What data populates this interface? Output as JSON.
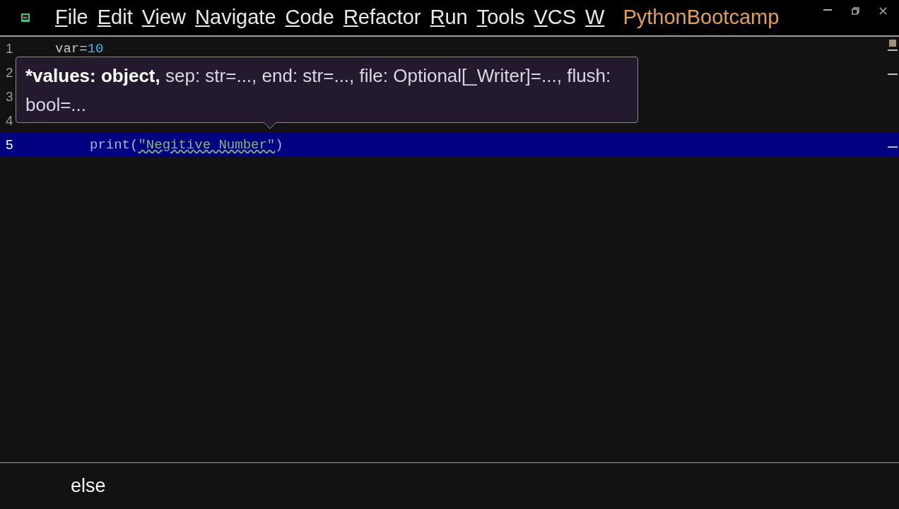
{
  "menu_bar": {
    "items": [
      "File",
      "Edit",
      "View",
      "Navigate",
      "Code",
      "Refactor",
      "Run",
      "Tools",
      "VCS",
      "W"
    ],
    "project_title": "PythonBootcamp"
  },
  "editor": {
    "lines": [
      {
        "number": "1",
        "tokens": [
          {
            "kind": "plain",
            "text": "var="
          },
          {
            "kind": "number",
            "text": "10"
          }
        ],
        "current": false
      },
      {
        "number": "2",
        "current": false
      },
      {
        "number": "3",
        "current": false
      },
      {
        "number": "4",
        "current": false,
        "children": [
          {
            "number": "5",
            "tokens": [
              {
                "kind": "call",
                "text": "print("
              },
              {
                "kind": "string",
                "text": "\"Negitive Number\""
              },
              {
                "kind": "call",
                "text": ")"
              }
            ],
            "current": true
          }
        ]
      }
    ]
  },
  "parameter_hint": {
    "parameters": [
      {
        "text": "*values: object,",
        "current": true
      },
      {
        "text": "sep: str=...,",
        "current": false
      },
      {
        "text": "end: str=...,",
        "current": false
      },
      {
        "text": "file: Optional[_Writer]=...,",
        "current": false
      },
      {
        "text": "flush: bool=...",
        "current": false
      }
    ]
  },
  "caption": "else"
}
